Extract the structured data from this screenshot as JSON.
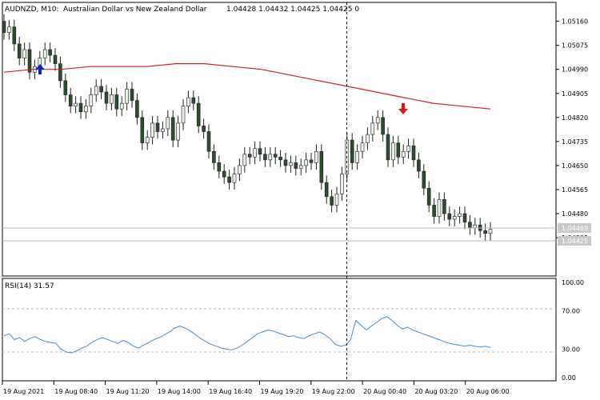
{
  "header": {
    "symbol": "AUDNZD, M10:",
    "description": "Australian Dollar vs New Zealand Dollar",
    "quote": "1.04428 1.04432 1.04425 1.04425  0"
  },
  "price_axis": {
    "labels": [
      "1.05160",
      "1.05075",
      "1.04990",
      "1.04905",
      "1.04820",
      "1.04735",
      "1.04650",
      "1.04565",
      "1.04480",
      "1.04395"
    ],
    "ask_tag": "1.04469",
    "bid_tag": "1.04425"
  },
  "rsi": {
    "label": "RSI(14) 31.57",
    "axis_labels": [
      "100.00",
      "70.00",
      "30.00",
      "0.00"
    ]
  },
  "time_axis": {
    "labels": [
      "19 Aug 2021",
      "19 Aug 08:40",
      "19 Aug 11:20",
      "19 Aug 14:00",
      "19 Aug 16:40",
      "19 Aug 19:20",
      "19 Aug 22:00",
      "20 Aug 00:40",
      "20 Aug 03:20",
      "20 Aug 06:00"
    ]
  },
  "colors": {
    "background": "#ffffff",
    "axis_text": "#000000",
    "bull_candle": "#e9efe6",
    "bear_candle": "#2b4d30",
    "wick": "#1e1e1e",
    "moving_average": "#d01f22",
    "rsi_line": "#3d8fd6",
    "level_line": "#b9b9b9",
    "buy_arrow": "#1020d0",
    "sell_arrow": "#e31010"
  },
  "chart_data": [
    {
      "type": "candlestick",
      "title": "AUDNZD, M10:",
      "price_range": [
        1.0435,
        1.0519
      ],
      "series": [
        {
          "name": "AUDNZD",
          "close": [
            1.0512,
            1.0514,
            1.0508,
            1.0503,
            1.0506,
            1.0498,
            1.05,
            1.0503,
            1.0506,
            1.0504,
            1.0501,
            1.0495,
            1.049,
            1.0486,
            1.0487,
            1.0484,
            1.0486,
            1.049,
            1.0493,
            1.0491,
            1.0487,
            1.049,
            1.0485,
            1.0487,
            1.0492,
            1.0488,
            1.0482,
            1.0473,
            1.0475,
            1.048,
            1.0477,
            1.0478,
            1.0482,
            1.0474,
            1.048,
            1.0486,
            1.0489,
            1.0487,
            1.0479,
            1.0477,
            1.047,
            1.0466,
            1.0463,
            1.0461,
            1.0459,
            1.0462,
            1.0465,
            1.0469,
            1.0468,
            1.0471,
            1.0469,
            1.0467,
            1.0469,
            1.0468,
            1.0467,
            1.0465,
            1.0466,
            1.0464,
            1.0465,
            1.0467,
            1.0466,
            1.047,
            1.0459,
            1.0454,
            1.0451,
            1.0455,
            1.0462,
            1.0474,
            1.0466,
            1.047,
            1.0473,
            1.0476,
            1.048,
            1.0482,
            1.0476,
            1.0467,
            1.0473,
            1.0468,
            1.047,
            1.0472,
            1.0467,
            1.0463,
            1.0457,
            1.0451,
            1.0447,
            1.0453,
            1.0448,
            1.0446,
            1.0447,
            1.0448,
            1.0445,
            1.0443,
            1.0444,
            1.0442,
            1.0441,
            1.04425
          ]
        }
      ],
      "indicators": [
        {
          "name": "moving-average",
          "color": "#d01f22",
          "values": [
            1.0498,
            1.0499,
            1.0499,
            1.05,
            1.05,
            1.05,
            1.0501,
            1.0501,
            1.05,
            1.0499,
            1.0497,
            1.0495,
            1.0493,
            1.0491,
            1.0489,
            1.0487,
            1.0486,
            1.0485
          ]
        }
      ],
      "markers": [
        {
          "type": "buy-arrow",
          "bar": 6
        },
        {
          "type": "sell-arrow",
          "bar": 74
        }
      ],
      "vertical_marker": "bar 64 (dashed)"
    },
    {
      "type": "line",
      "title": "RSI(14) 31.57",
      "ylim": [
        0,
        100
      ],
      "levels": [
        70,
        30
      ],
      "series": [
        {
          "name": "RSI(14)",
          "values": [
            44,
            46,
            40,
            42,
            38,
            41,
            43,
            40,
            38,
            37,
            36,
            30,
            27,
            26,
            28,
            31,
            33,
            37,
            40,
            42,
            40,
            38,
            36,
            39,
            37,
            33,
            31,
            34,
            37,
            40,
            42,
            45,
            48,
            52,
            54,
            52,
            49,
            45,
            41,
            38,
            35,
            33,
            31,
            30,
            29,
            31,
            34,
            38,
            42,
            46,
            48,
            50,
            49,
            47,
            45,
            43,
            44,
            42,
            41,
            44,
            46,
            48,
            45,
            41,
            35,
            33,
            34,
            40,
            60,
            55,
            50,
            54,
            58,
            62,
            64,
            60,
            55,
            51,
            53,
            50,
            48,
            46,
            44,
            42,
            40,
            38,
            36,
            35,
            34,
            33,
            34,
            33,
            32,
            33,
            31.57
          ]
        }
      ]
    }
  ]
}
